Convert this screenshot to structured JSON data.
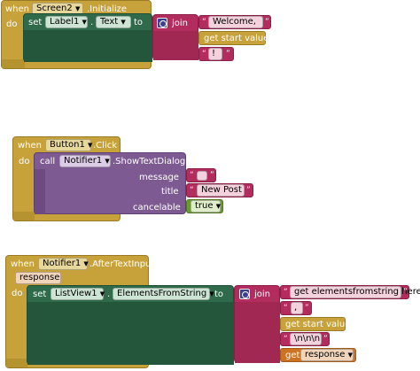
{
  "block1": {
    "when": "when",
    "component": "Screen2",
    "event": ".Initialize",
    "do": "do",
    "set": "set",
    "target": "Label1",
    "dot": ".",
    "property": "Text",
    "to": "to",
    "join": "join",
    "items": [
      "Welcome,",
      "get start value",
      "!"
    ]
  },
  "block2": {
    "when": "when",
    "component": "Button1",
    "event": ".Click",
    "do": "do",
    "call": "call",
    "target": "Notifier1",
    "method": ".ShowTextDialog",
    "message_label": "message",
    "message_value": "",
    "title_label": "title",
    "title_value": "New Post",
    "cancelable_label": "cancelable",
    "cancelable_value": "true"
  },
  "block3": {
    "when": "when",
    "component": "Notifier1",
    "event": ".AfterTextInput",
    "param": "response",
    "do": "do",
    "set": "set",
    "target": "ListView1",
    "dot": ".",
    "property": "ElementsFromString",
    "to": "to",
    "join": "join",
    "items": [
      "get elementsfromstring here",
      ",",
      "get start value",
      "\\n\\n\\n",
      "get",
      "response"
    ]
  },
  "colors": {
    "event": "#c7a13a",
    "setter": "#2f6b4a",
    "call": "#7d5a92",
    "text": "#b32c5e",
    "logic": "#6b9a33",
    "variable": "#cc7322"
  }
}
